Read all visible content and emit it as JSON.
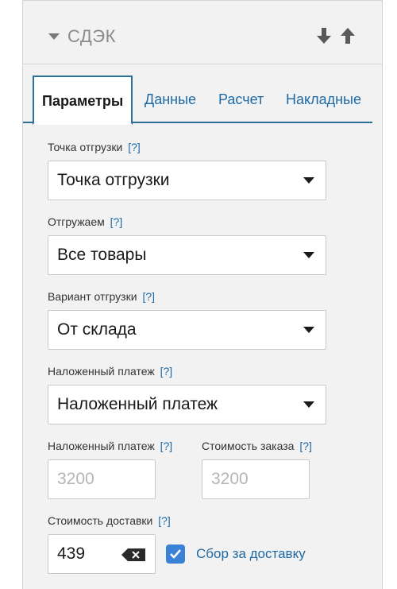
{
  "panel": {
    "title": "СДЭК",
    "icons": {
      "collapse": "caret-down-icon",
      "move_down": "arrow-down-icon",
      "move_up": "arrow-up-icon"
    }
  },
  "tabs": [
    {
      "label": "Параметры",
      "active": true
    },
    {
      "label": "Данные",
      "active": false
    },
    {
      "label": "Расчет",
      "active": false
    },
    {
      "label": "Накладные",
      "active": false
    }
  ],
  "help_marker": "[?]",
  "fields": {
    "shipment_point": {
      "label": "Точка отгрузки",
      "value": "Точка отгрузки"
    },
    "shipping_items": {
      "label": "Отгружаем",
      "value": "Все товары"
    },
    "shipment_option": {
      "label": "Вариант отгрузки",
      "value": "От склада"
    },
    "cod_mode": {
      "label": "Наложенный платеж",
      "value": "Наложенный платеж"
    },
    "cod_amount": {
      "label": "Наложенный платеж",
      "placeholder": "3200"
    },
    "order_cost": {
      "label": "Стоимость заказа",
      "placeholder": "3200"
    },
    "delivery_cost": {
      "label": "Стоимость доставки",
      "value": "439"
    },
    "delivery_fee": {
      "label": "Сбор за доставку",
      "checked": true
    }
  },
  "colors": {
    "accent": "#1f6aa5",
    "checkbox": "#3b82d6",
    "tab_border": "#2a6f97"
  }
}
